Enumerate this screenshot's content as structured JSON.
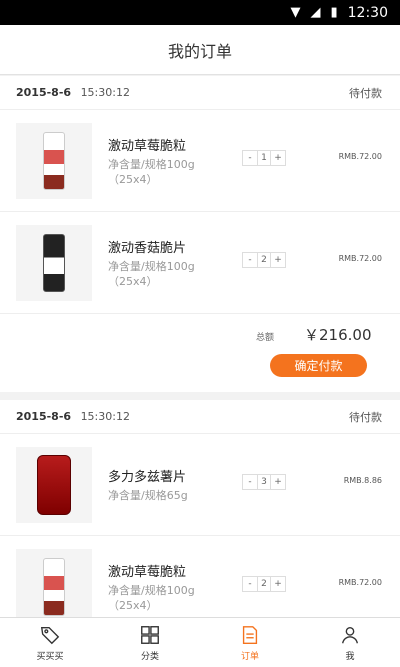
{
  "status_bar": {
    "time": "12:30",
    "icons": [
      "wifi-icon",
      "signal-icon",
      "battery-icon"
    ]
  },
  "header": {
    "title": "我的订单"
  },
  "colors": {
    "accent": "#f4731e"
  },
  "orders": [
    {
      "date": "2015-8-6",
      "time": "15:30:12",
      "status": "待付款",
      "items": [
        {
          "name": "激动草莓脆粒",
          "spec": "净含量/规格100g（25x4）",
          "qty": "1",
          "price": "RMB.72.00",
          "image": "strawberry-pack"
        },
        {
          "name": "激动香菇脆片",
          "spec": "净含量/规格100g（25x4）",
          "qty": "2",
          "price": "RMB.72.00",
          "image": "mushroom-pack"
        }
      ],
      "total_label": "总额",
      "total_amount": "￥216.00",
      "pay_label": "确定付款"
    },
    {
      "date": "2015-8-6",
      "time": "15:30:12",
      "status": "待付款",
      "items": [
        {
          "name": "多力多兹薯片",
          "spec": "净含量/规格65g",
          "qty": "3",
          "price": "RMB.8.86",
          "image": "doritos-bag"
        },
        {
          "name": "激动草莓脆粒",
          "spec": "净含量/规格100g（25x4）",
          "qty": "2",
          "price": "RMB.72.00",
          "image": "strawberry-pack"
        }
      ]
    }
  ],
  "stepper": {
    "minus": "-",
    "plus": "+"
  },
  "tabs": [
    {
      "label": "买买买",
      "icon": "tag-icon"
    },
    {
      "label": "分类",
      "icon": "grid-icon"
    },
    {
      "label": "订单",
      "icon": "order-icon",
      "active": true
    },
    {
      "label": "我",
      "icon": "user-icon"
    }
  ]
}
